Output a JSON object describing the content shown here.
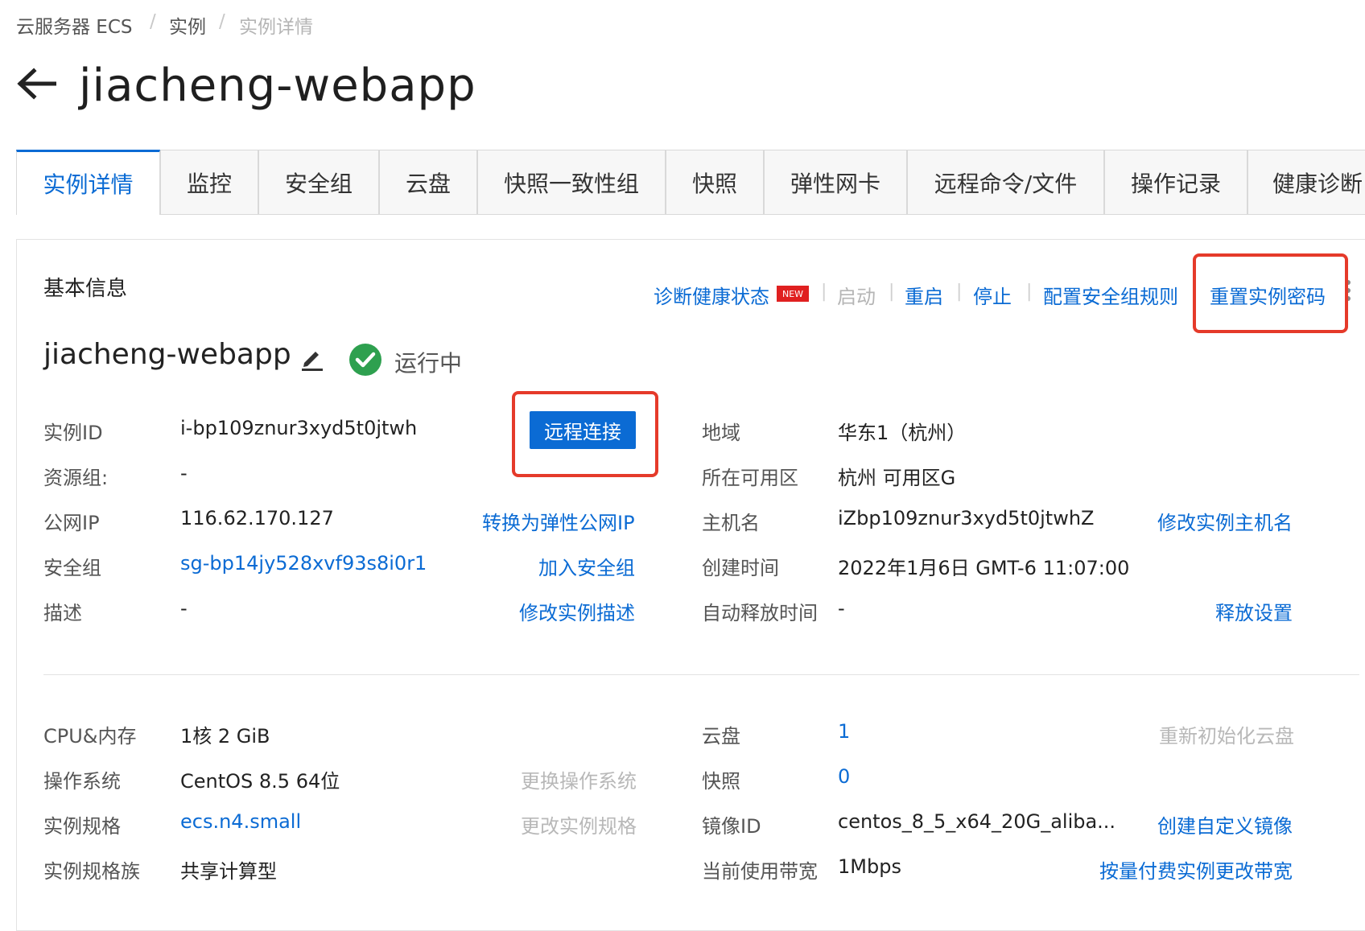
{
  "breadcrumb": {
    "items": [
      "云服务器 ECS",
      "实例",
      "实例详情"
    ],
    "separator": "/"
  },
  "page": {
    "title": "jiacheng-webapp"
  },
  "tabs": [
    "实例详情",
    "监控",
    "安全组",
    "云盘",
    "快照一致性组",
    "快照",
    "弹性网卡",
    "远程命令/文件",
    "操作记录",
    "健康诊断"
  ],
  "basic": {
    "title": "基本信息",
    "actions": {
      "diagnose": "诊断健康状态",
      "new_badge": "NEW",
      "start": "启动",
      "restart": "重启",
      "stop": "停止",
      "sg_rules": "配置安全组规则",
      "reset_password": "重置实例密码"
    },
    "instance_name": "jiacheng-webapp",
    "status": "运行中",
    "remote_connect": "远程连接"
  },
  "info_left": [
    {
      "label": "实例ID",
      "value": "i-bp109znur3xyd5t0jtwh"
    },
    {
      "label": "资源组:",
      "value": "-"
    },
    {
      "label": "公网IP",
      "value": "116.62.170.127",
      "action": "转换为弹性公网IP"
    },
    {
      "label": "安全组",
      "value": "sg-bp14jy528xvf93s8i0r1",
      "action": "加入安全组"
    },
    {
      "label": "描述",
      "value": "-",
      "action": "修改实例描述"
    }
  ],
  "info_right": [
    {
      "label": "地域",
      "value": "华东1（杭州）"
    },
    {
      "label": "所在可用区",
      "value": "杭州 可用区G"
    },
    {
      "label": "主机名",
      "value": "iZbp109znur3xyd5t0jtwhZ",
      "action": "修改实例主机名"
    },
    {
      "label": "创建时间",
      "value": "2022年1月6日 GMT-6 11:07:00"
    },
    {
      "label": "自动释放时间",
      "value": "-",
      "action": "释放设置"
    }
  ],
  "spec_left": [
    {
      "label": "CPU&内存",
      "value": "1核 2 GiB"
    },
    {
      "label": "操作系统",
      "value": "CentOS 8.5 64位",
      "action": "更换操作系统"
    },
    {
      "label": "实例规格",
      "value": "ecs.n4.small",
      "action": "更改实例规格"
    },
    {
      "label": "实例规格族",
      "value": "共享计算型"
    }
  ],
  "spec_right": [
    {
      "label": "云盘",
      "value": "1",
      "action": "重新初始化云盘"
    },
    {
      "label": "快照",
      "value": "0"
    },
    {
      "label": "镜像ID",
      "value": "centos_8_5_x64_20G_aliba...",
      "action": "创建自定义镜像"
    },
    {
      "label": "当前使用带宽",
      "value": "1Mbps",
      "action": "按量付费实例更改带宽"
    }
  ],
  "colors": {
    "accent": "#0b6bd4",
    "highlight": "#e53a2a",
    "success": "#2ea04f",
    "new_badge": "#e02020"
  }
}
